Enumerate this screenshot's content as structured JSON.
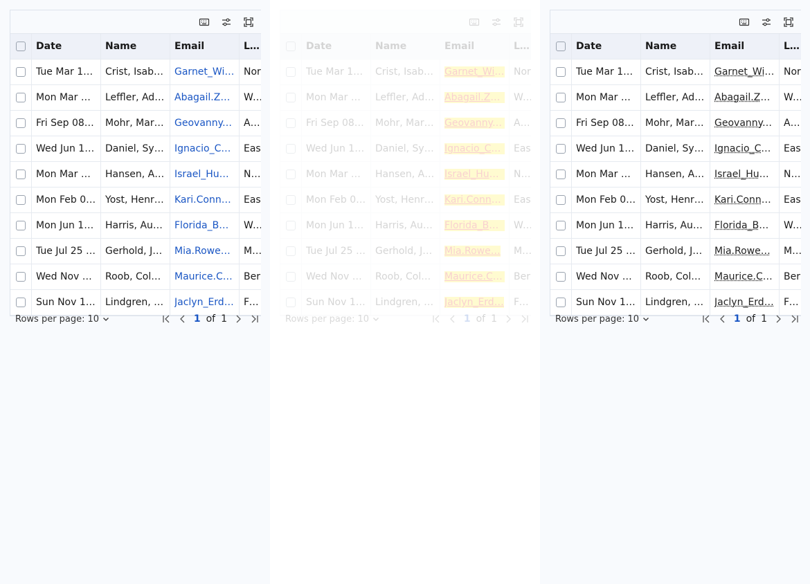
{
  "columns": {
    "date": "Date",
    "name": "Name",
    "email": "Email",
    "location": "Loc"
  },
  "toolbar": {
    "icons": [
      "keyboard-icon",
      "filter-sliders-icon",
      "fullscreen-icon"
    ]
  },
  "rows": [
    {
      "date": "Tue Mar 1…",
      "name": "Crist, Isabe…",
      "email": "Garnet_Wie…",
      "location": "Nor"
    },
    {
      "date": "Mon Mar 2…",
      "name": "Leffler, Ad…",
      "email": "Abagail.Ze…",
      "location": "Wes"
    },
    {
      "date": "Fri Sep 08 …",
      "name": "Mohr, Maril…",
      "email": "Geovanny.…",
      "location": "Aniy"
    },
    {
      "date": "Wed Jun 1…",
      "name": "Daniel, Syl…",
      "email": "Ignacio_Ca…",
      "location": "Eas"
    },
    {
      "date": "Mon Mar 0…",
      "name": "Hansen, As…",
      "email": "Israel_Huel…",
      "location": "Nev"
    },
    {
      "date": "Mon Feb 0…",
      "name": "Yost, Henri…",
      "email": "Kari.Connel…",
      "location": "Eas"
    },
    {
      "date": "Mon Jun 1…",
      "name": "Harris, Aus…",
      "email": "Florida_Buc…",
      "location": "Wes"
    },
    {
      "date": "Tue Jul 25 …",
      "name": "Gerhold, Je…",
      "email": "Mia.Rowe…",
      "location": "Mer"
    },
    {
      "date": "Wed Nov 0…",
      "name": "Roob, Colu…",
      "email": "Maurice.Co…",
      "location": "Ber"
    },
    {
      "date": "Sun Nov 1…",
      "name": "Lindgren, E…",
      "email": "Jaclyn_Erd…",
      "location": "Fort"
    }
  ],
  "footer": {
    "rows_per_page_label": "Rows per page:",
    "rows_per_page_value": "10",
    "page": "1",
    "of": "of",
    "total": "1"
  },
  "colors": {
    "accent": "#1a56c4",
    "header_bg": "#eef1f8",
    "panel_bg": "#f8fafd"
  }
}
